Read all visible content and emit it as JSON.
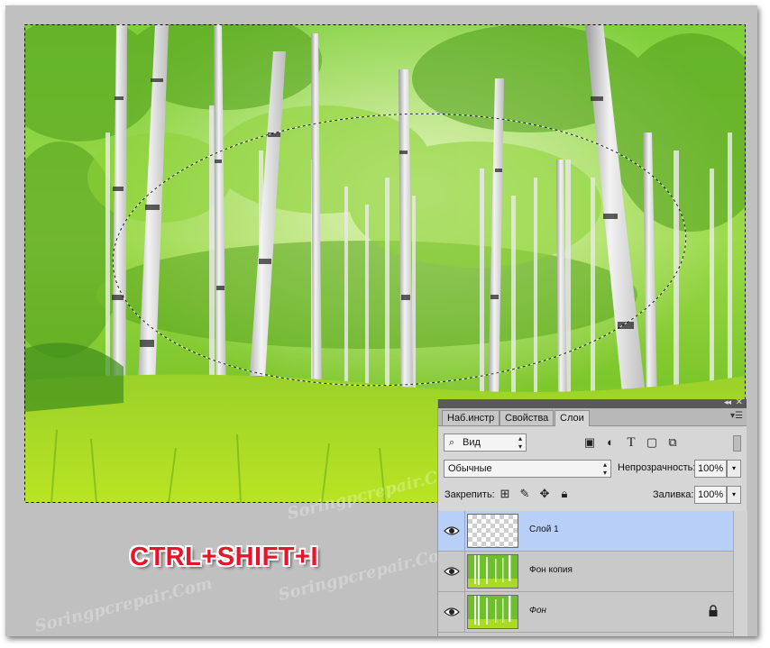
{
  "panel": {
    "tabs": [
      {
        "label": "Наб.инстр"
      },
      {
        "label": "Свойства"
      },
      {
        "label": "Слои"
      }
    ],
    "filter": {
      "label": "Вид"
    },
    "blend_mode": "Обычные",
    "opacity": {
      "label": "Непрозрачность:",
      "value": "100%"
    },
    "lock": {
      "label": "Закрепить:"
    },
    "fill": {
      "label": "Заливка:",
      "value": "100%"
    },
    "layers": [
      {
        "name": "Слой 1",
        "selected": true,
        "thumbnail": "transparent"
      },
      {
        "name": "Фон копия",
        "selected": false,
        "thumbnail": "forest"
      },
      {
        "name": "Фон",
        "selected": false,
        "thumbnail": "forest",
        "locked": true
      }
    ],
    "icons": [
      "search-icon",
      "image-filter-icon",
      "adjustment-filter-icon",
      "type-filter-icon",
      "shape-filter-icon",
      "smart-object-filter-icon",
      "lock-pixels-icon",
      "lock-brush-icon",
      "lock-position-icon",
      "lock-all-icon",
      "eye-icon",
      "lock-icon"
    ]
  },
  "overlay": {
    "hotkey": "CTRL+SHIFT+I",
    "watermark": "Soringpcrepair.Com"
  },
  "colors": {
    "hotkey": "#e8142a",
    "selected_layer": "#b8cff7",
    "foliage": "#7cc62a"
  }
}
